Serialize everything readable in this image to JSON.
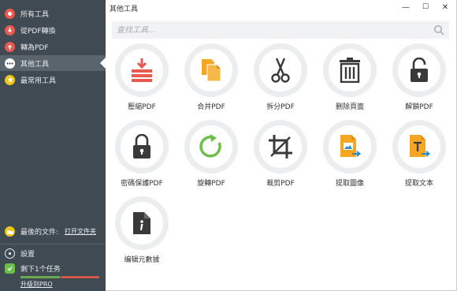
{
  "sidebar": {
    "items": [
      {
        "label": "所有工具",
        "icon": "all-tools-icon",
        "color": "#e85a4f"
      },
      {
        "label": "從PDF轉換",
        "icon": "from-pdf-icon",
        "color": "#e85a4f"
      },
      {
        "label": "轉為PDF",
        "icon": "to-pdf-icon",
        "color": "#e85a4f"
      },
      {
        "label": "其他工具",
        "icon": "more-tools-icon",
        "color": "#ffffff"
      },
      {
        "label": "最常用工具",
        "icon": "star-icon",
        "color": "#f0c419"
      }
    ],
    "recent_label": "最後的文件:",
    "open_file_label": "打开文件夹",
    "settings_label": "設置",
    "tasks_label": "剩下1个任务",
    "tasks_progress": 0.5,
    "upgrade_label": "升级到PRO"
  },
  "window": {
    "title": "其他工具",
    "minimize": "—",
    "maximize": "☐",
    "close": "✕"
  },
  "search": {
    "placeholder": "查找工具..."
  },
  "tools": [
    {
      "label": "壓縮PDF",
      "icon": "compress-icon"
    },
    {
      "label": "合并PDF",
      "icon": "merge-icon"
    },
    {
      "label": "拆分PDF",
      "icon": "scissors-icon"
    },
    {
      "label": "删除頁面",
      "icon": "trash-icon"
    },
    {
      "label": "解鎖PDF",
      "icon": "unlock-icon"
    },
    {
      "label": "密碼保護PDF",
      "icon": "lock-icon"
    },
    {
      "label": "旋轉PDF",
      "icon": "rotate-icon"
    },
    {
      "label": "裁剪PDF",
      "icon": "crop-icon"
    },
    {
      "label": "提取圖像",
      "icon": "extract-image-icon"
    },
    {
      "label": "提取文本",
      "icon": "extract-text-icon"
    },
    {
      "label": "编辑元數據",
      "icon": "metadata-icon"
    }
  ],
  "colors": {
    "sidebar_bg": "#3f4a52",
    "accent_red": "#e85a4f",
    "accent_orange": "#f5a623",
    "accent_green": "#6cc04a",
    "icon_dark": "#3a3a3a",
    "accent_blue": "#2a8ad4"
  }
}
